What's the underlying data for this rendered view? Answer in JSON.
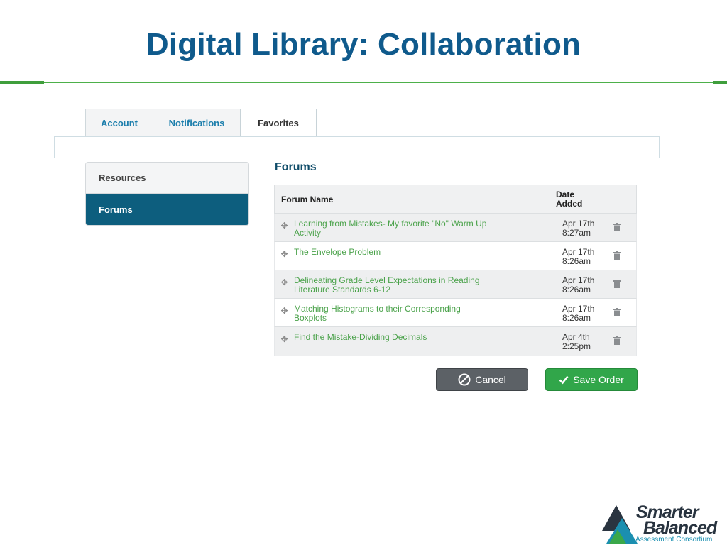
{
  "slide": {
    "title": "Digital Library: Collaboration"
  },
  "tabs": [
    {
      "label": "Account"
    },
    {
      "label": "Notifications"
    },
    {
      "label": "Favorites",
      "active": true
    }
  ],
  "sidebar": {
    "items": [
      {
        "label": "Resources"
      },
      {
        "label": "Forums",
        "active": true
      }
    ]
  },
  "forums": {
    "heading": "Forums",
    "columns": {
      "name": "Forum Name",
      "date_line1": "Date",
      "date_line2": "Added"
    },
    "rows": [
      {
        "name": "Learning from Mistakes- My favorite \"No\" Warm Up Activity",
        "date": "Apr 17th",
        "time": "8:27am"
      },
      {
        "name": "The Envelope Problem",
        "date": "Apr 17th",
        "time": "8:26am"
      },
      {
        "name": "Delineating Grade Level Expectations in Reading Literature Standards 6-12",
        "date": "Apr 17th",
        "time": "8:26am"
      },
      {
        "name": "Matching Histograms to their Corresponding Boxplots",
        "date": "Apr 17th",
        "time": "8:26am"
      },
      {
        "name": "Find the Mistake-Dividing Decimals",
        "date": "Apr 4th",
        "time": "2:25pm"
      }
    ]
  },
  "actions": {
    "cancel": "Cancel",
    "save": "Save Order"
  },
  "logo": {
    "line1": "Smarter",
    "line2": "Balanced",
    "line3": "Assessment Consortium"
  },
  "colors": {
    "title": "#0f5a8c",
    "accent_green": "#4db04a",
    "sidebar_active": "#0d5e7e",
    "link_green": "#4aa24a"
  }
}
